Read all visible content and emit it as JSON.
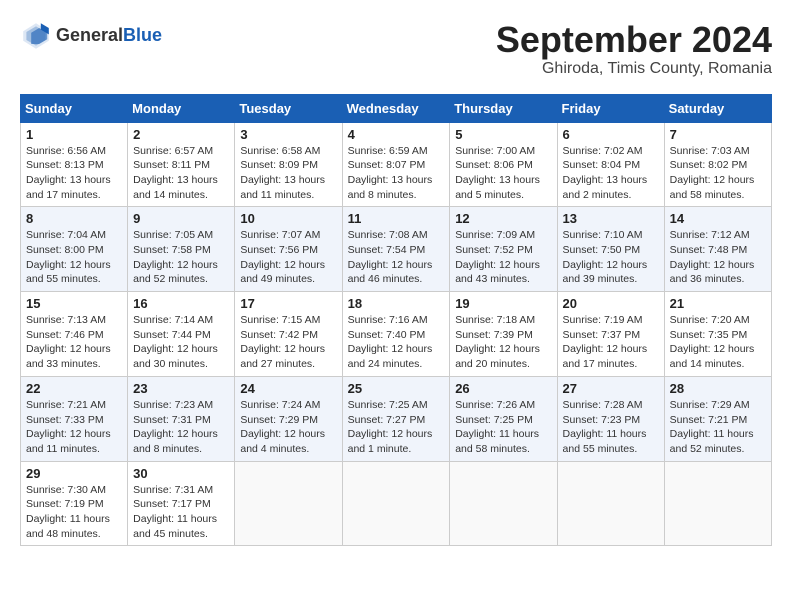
{
  "header": {
    "logo_general": "General",
    "logo_blue": "Blue",
    "month_title": "September 2024",
    "subtitle": "Ghiroda, Timis County, Romania"
  },
  "weekdays": [
    "Sunday",
    "Monday",
    "Tuesday",
    "Wednesday",
    "Thursday",
    "Friday",
    "Saturday"
  ],
  "weeks": [
    [
      {
        "day": "1",
        "info": "Sunrise: 6:56 AM\nSunset: 8:13 PM\nDaylight: 13 hours and 17 minutes."
      },
      {
        "day": "2",
        "info": "Sunrise: 6:57 AM\nSunset: 8:11 PM\nDaylight: 13 hours and 14 minutes."
      },
      {
        "day": "3",
        "info": "Sunrise: 6:58 AM\nSunset: 8:09 PM\nDaylight: 13 hours and 11 minutes."
      },
      {
        "day": "4",
        "info": "Sunrise: 6:59 AM\nSunset: 8:07 PM\nDaylight: 13 hours and 8 minutes."
      },
      {
        "day": "5",
        "info": "Sunrise: 7:00 AM\nSunset: 8:06 PM\nDaylight: 13 hours and 5 minutes."
      },
      {
        "day": "6",
        "info": "Sunrise: 7:02 AM\nSunset: 8:04 PM\nDaylight: 13 hours and 2 minutes."
      },
      {
        "day": "7",
        "info": "Sunrise: 7:03 AM\nSunset: 8:02 PM\nDaylight: 12 hours and 58 minutes."
      }
    ],
    [
      {
        "day": "8",
        "info": "Sunrise: 7:04 AM\nSunset: 8:00 PM\nDaylight: 12 hours and 55 minutes."
      },
      {
        "day": "9",
        "info": "Sunrise: 7:05 AM\nSunset: 7:58 PM\nDaylight: 12 hours and 52 minutes."
      },
      {
        "day": "10",
        "info": "Sunrise: 7:07 AM\nSunset: 7:56 PM\nDaylight: 12 hours and 49 minutes."
      },
      {
        "day": "11",
        "info": "Sunrise: 7:08 AM\nSunset: 7:54 PM\nDaylight: 12 hours and 46 minutes."
      },
      {
        "day": "12",
        "info": "Sunrise: 7:09 AM\nSunset: 7:52 PM\nDaylight: 12 hours and 43 minutes."
      },
      {
        "day": "13",
        "info": "Sunrise: 7:10 AM\nSunset: 7:50 PM\nDaylight: 12 hours and 39 minutes."
      },
      {
        "day": "14",
        "info": "Sunrise: 7:12 AM\nSunset: 7:48 PM\nDaylight: 12 hours and 36 minutes."
      }
    ],
    [
      {
        "day": "15",
        "info": "Sunrise: 7:13 AM\nSunset: 7:46 PM\nDaylight: 12 hours and 33 minutes."
      },
      {
        "day": "16",
        "info": "Sunrise: 7:14 AM\nSunset: 7:44 PM\nDaylight: 12 hours and 30 minutes."
      },
      {
        "day": "17",
        "info": "Sunrise: 7:15 AM\nSunset: 7:42 PM\nDaylight: 12 hours and 27 minutes."
      },
      {
        "day": "18",
        "info": "Sunrise: 7:16 AM\nSunset: 7:40 PM\nDaylight: 12 hours and 24 minutes."
      },
      {
        "day": "19",
        "info": "Sunrise: 7:18 AM\nSunset: 7:39 PM\nDaylight: 12 hours and 20 minutes."
      },
      {
        "day": "20",
        "info": "Sunrise: 7:19 AM\nSunset: 7:37 PM\nDaylight: 12 hours and 17 minutes."
      },
      {
        "day": "21",
        "info": "Sunrise: 7:20 AM\nSunset: 7:35 PM\nDaylight: 12 hours and 14 minutes."
      }
    ],
    [
      {
        "day": "22",
        "info": "Sunrise: 7:21 AM\nSunset: 7:33 PM\nDaylight: 12 hours and 11 minutes."
      },
      {
        "day": "23",
        "info": "Sunrise: 7:23 AM\nSunset: 7:31 PM\nDaylight: 12 hours and 8 minutes."
      },
      {
        "day": "24",
        "info": "Sunrise: 7:24 AM\nSunset: 7:29 PM\nDaylight: 12 hours and 4 minutes."
      },
      {
        "day": "25",
        "info": "Sunrise: 7:25 AM\nSunset: 7:27 PM\nDaylight: 12 hours and 1 minute."
      },
      {
        "day": "26",
        "info": "Sunrise: 7:26 AM\nSunset: 7:25 PM\nDaylight: 11 hours and 58 minutes."
      },
      {
        "day": "27",
        "info": "Sunrise: 7:28 AM\nSunset: 7:23 PM\nDaylight: 11 hours and 55 minutes."
      },
      {
        "day": "28",
        "info": "Sunrise: 7:29 AM\nSunset: 7:21 PM\nDaylight: 11 hours and 52 minutes."
      }
    ],
    [
      {
        "day": "29",
        "info": "Sunrise: 7:30 AM\nSunset: 7:19 PM\nDaylight: 11 hours and 48 minutes."
      },
      {
        "day": "30",
        "info": "Sunrise: 7:31 AM\nSunset: 7:17 PM\nDaylight: 11 hours and 45 minutes."
      },
      null,
      null,
      null,
      null,
      null
    ]
  ]
}
